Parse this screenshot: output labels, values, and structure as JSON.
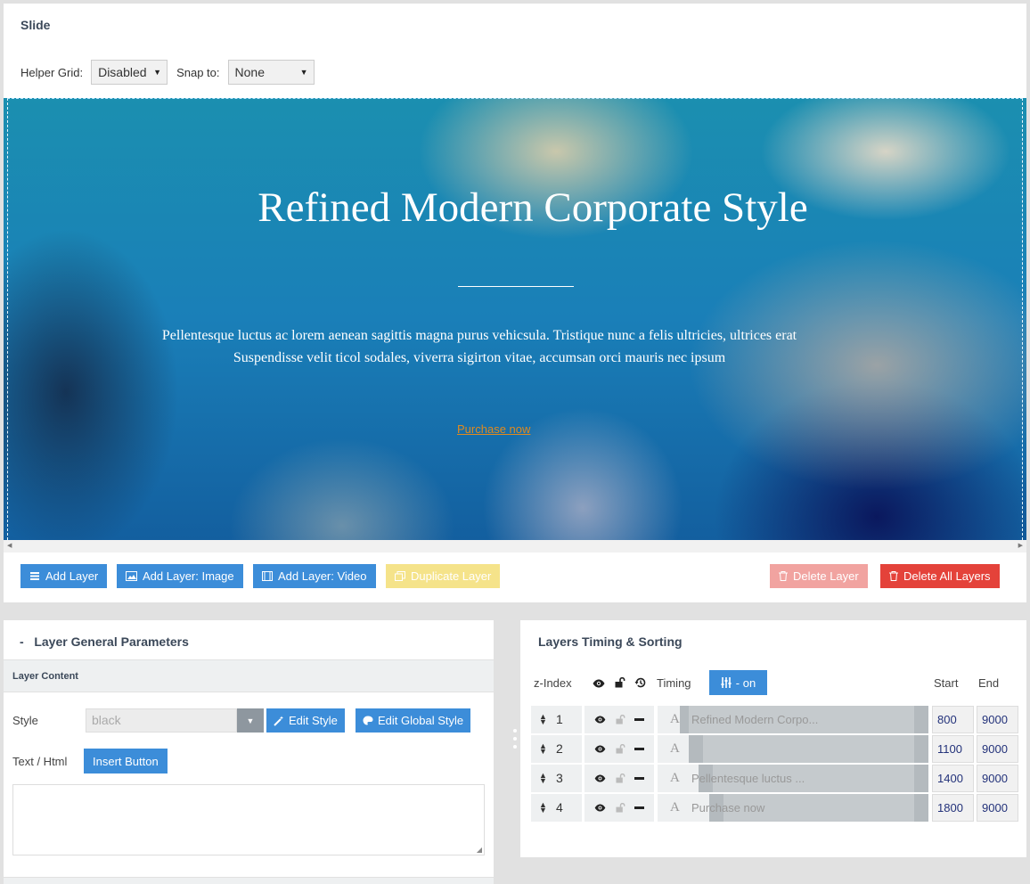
{
  "slide": {
    "title": "Slide",
    "helper_grid_label": "Helper Grid:",
    "helper_grid_value": "Disabled",
    "snap_label": "Snap to:",
    "snap_value": "None"
  },
  "canvas": {
    "title": "Refined Modern Corporate Style",
    "text_line1": "Pellentesque luctus ac lorem aenean sagittis magna purus vehicsula. Tristique nunc a felis ultricies, ultrices erat",
    "text_line2": "Suspendisse velit ticol sodales, viverra sigirton vitae, accumsan orci mauris nec ipsum",
    "link": "Purchase now"
  },
  "toolbar": {
    "add_layer": "Add Layer",
    "add_image": "Add Layer: Image",
    "add_video": "Add Layer: Video",
    "duplicate": "Duplicate Layer",
    "delete": "Delete Layer",
    "delete_all": "Delete All Layers"
  },
  "params": {
    "title": "Layer General Parameters",
    "collapse": "-",
    "content_label": "Layer Content",
    "style_label": "Style",
    "style_value": "black",
    "edit_style": "Edit Style",
    "edit_global_style": "Edit Global Style",
    "text_html_label": "Text / Html",
    "insert_button": "Insert Button"
  },
  "timing": {
    "title": "Layers Timing & Sorting",
    "col_zindex": "z-Index",
    "col_timing": "Timing",
    "on_label": "- on",
    "col_start": "Start",
    "col_end": "End",
    "layers": [
      {
        "index": "1",
        "label": "Refined Modern Corpo...",
        "start": "800",
        "end": "9000"
      },
      {
        "index": "2",
        "label": "",
        "start": "1100",
        "end": "9000"
      },
      {
        "index": "3",
        "label": "Pellentesque luctus ...",
        "start": "1400",
        "end": "9000"
      },
      {
        "index": "4",
        "label": "Purchase now",
        "start": "1800",
        "end": "9000"
      }
    ]
  },
  "colors": {
    "accent": "#3c8dd9",
    "danger": "#e4423a",
    "danger_light": "#f1a3a0",
    "warning_light": "#f5e38a",
    "heading": "#3b4859"
  }
}
